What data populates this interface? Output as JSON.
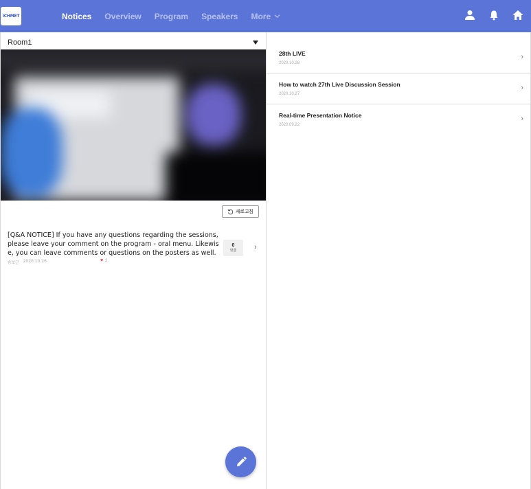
{
  "header": {
    "logo_text": "ICHMET",
    "nav": [
      {
        "label": "Notices",
        "active": true
      },
      {
        "label": "Overview",
        "active": false
      },
      {
        "label": "Program",
        "active": false
      },
      {
        "label": "Speakers",
        "active": false
      }
    ],
    "more_label": "More",
    "icons": [
      "user-icon",
      "bell-icon",
      "home-icon"
    ],
    "accent_color": "#5b74d8"
  },
  "room": {
    "selected": "Room1"
  },
  "refresh": {
    "label": "새로고침"
  },
  "post": {
    "text": "[Q&A NOTICE] If you have any questions regarding the sessions, please leave your comment on the program - oral menu. Likewise, you can leave comments or questions on the posters as well.",
    "author": "송보근",
    "date": "2020.10.26",
    "likes": "2",
    "comment_count": "0",
    "comment_label": "댓글"
  },
  "notices": [
    {
      "title": "28th LIVE",
      "date": "2020.10.28"
    },
    {
      "title": "How to watch 27th Live Discussion Session",
      "date": "2020.10.27"
    },
    {
      "title": "Real-time Presentation Notice",
      "date": "2020.09.22"
    }
  ]
}
